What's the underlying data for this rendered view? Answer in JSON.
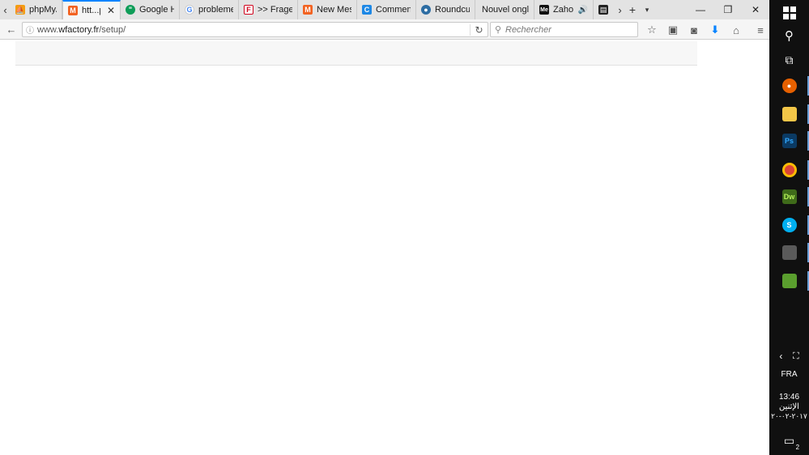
{
  "tabs": [
    {
      "title": "phpMyA...",
      "icon": "phpmyadmin-icon",
      "color": "#f39c12"
    },
    {
      "title": "htt...p/",
      "icon": "magento-icon",
      "color": "#f26322",
      "active": true
    },
    {
      "title": "Google H...",
      "icon": "google-hangouts-icon",
      "color": "#0f9d58"
    },
    {
      "title": "probleme...",
      "icon": "google-icon",
      "color": "#4285f4"
    },
    {
      "title": ">> Frage...",
      "icon": "frage-icon",
      "color": "#d0021b"
    },
    {
      "title": "New Mes...",
      "icon": "magento-icon",
      "color": "#f26322"
    },
    {
      "title": "Commen...",
      "icon": "comment-icon",
      "color": "#1e88e5"
    },
    {
      "title": "Roundcu...",
      "icon": "roundcube-icon",
      "color": "#2d6da3"
    },
    {
      "title": "Nouvel onglet",
      "icon": "",
      "color": ""
    },
    {
      "title": "Zaho ...",
      "icon": "zaho-icon",
      "color": "#111111",
      "audio": true
    },
    {
      "title": "[",
      "icon": "bookmark-icon",
      "color": "#222222"
    }
  ],
  "address": {
    "url_prefix": "www.",
    "url_host": "wfactory.fr",
    "url_path": "/setup/"
  },
  "search": {
    "placeholder": "Rechercher"
  },
  "taskbar": {
    "language": "FRA",
    "time": "13:46",
    "day": "الإثنين",
    "date": "٢٠١٧-٠٢-٢٠",
    "notifications": "2",
    "apps": [
      {
        "name": "firefox-icon",
        "color": "#e66000",
        "label": "",
        "running": true
      },
      {
        "name": "file-explorer-icon",
        "color": "#f3c648",
        "label": "",
        "running": true
      },
      {
        "name": "photoshop-icon",
        "color": "#0b3a63",
        "label": "Ps",
        "running": true
      },
      {
        "name": "chrome-icon",
        "color": "#db4437",
        "label": "",
        "running": true
      },
      {
        "name": "dreamweaver-icon",
        "color": "#3f6b1a",
        "label": "Dw",
        "running": true
      },
      {
        "name": "skype-icon",
        "color": "#00aff0",
        "label": "S",
        "running": true
      },
      {
        "name": "tool-icon",
        "color": "#5a5a5a",
        "label": "",
        "running": true
      },
      {
        "name": "editor-icon",
        "color": "#5a9e2e",
        "label": "",
        "running": true
      }
    ]
  }
}
